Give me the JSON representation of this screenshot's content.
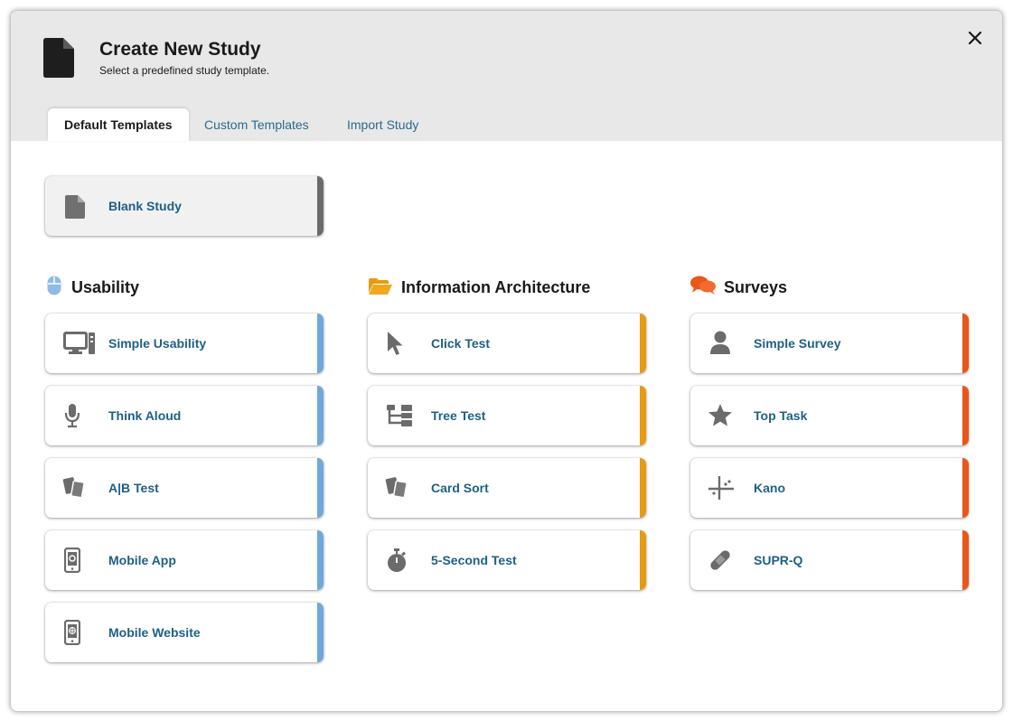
{
  "dialog": {
    "title": "Create New Study",
    "subtitle": "Select a predefined study template.",
    "close_icon": "close-icon"
  },
  "tabs": [
    {
      "label": "Default Templates",
      "active": true
    },
    {
      "label": "Custom Templates",
      "active": false
    },
    {
      "label": "Import Study",
      "active": false
    }
  ],
  "blank": {
    "label": "Blank Study",
    "icon": "document-icon"
  },
  "colors": {
    "usability": "#6fa8dc",
    "information_architecture": "#e69b12",
    "surveys": "#e8571a",
    "blank": "#6b6b6b",
    "link": "#1f5f85"
  },
  "sections": {
    "usability": {
      "title": "Usability",
      "icon": "mouse-icon",
      "items": [
        {
          "label": "Simple Usability",
          "icon": "desktop-computer-icon"
        },
        {
          "label": "Think Aloud",
          "icon": "microphone-icon"
        },
        {
          "label": "A|B Test",
          "icon": "cards-icon"
        },
        {
          "label": "Mobile App",
          "icon": "mobile-app-icon"
        },
        {
          "label": "Mobile Website",
          "icon": "mobile-web-icon"
        }
      ]
    },
    "ia": {
      "title": "Information Architecture",
      "icon": "folder-open-icon",
      "items": [
        {
          "label": "Click Test",
          "icon": "cursor-icon"
        },
        {
          "label": "Tree Test",
          "icon": "tree-icon"
        },
        {
          "label": "Card Sort",
          "icon": "cards-icon"
        },
        {
          "label": "5-Second Test",
          "icon": "stopwatch-icon"
        }
      ]
    },
    "surveys": {
      "title": "Surveys",
      "icon": "chat-bubbles-icon",
      "items": [
        {
          "label": "Simple Survey",
          "icon": "person-icon"
        },
        {
          "label": "Top Task",
          "icon": "star-icon"
        },
        {
          "label": "Kano",
          "icon": "crosshair-icon"
        },
        {
          "label": "SUPR-Q",
          "icon": "bandage-icon"
        }
      ]
    }
  }
}
